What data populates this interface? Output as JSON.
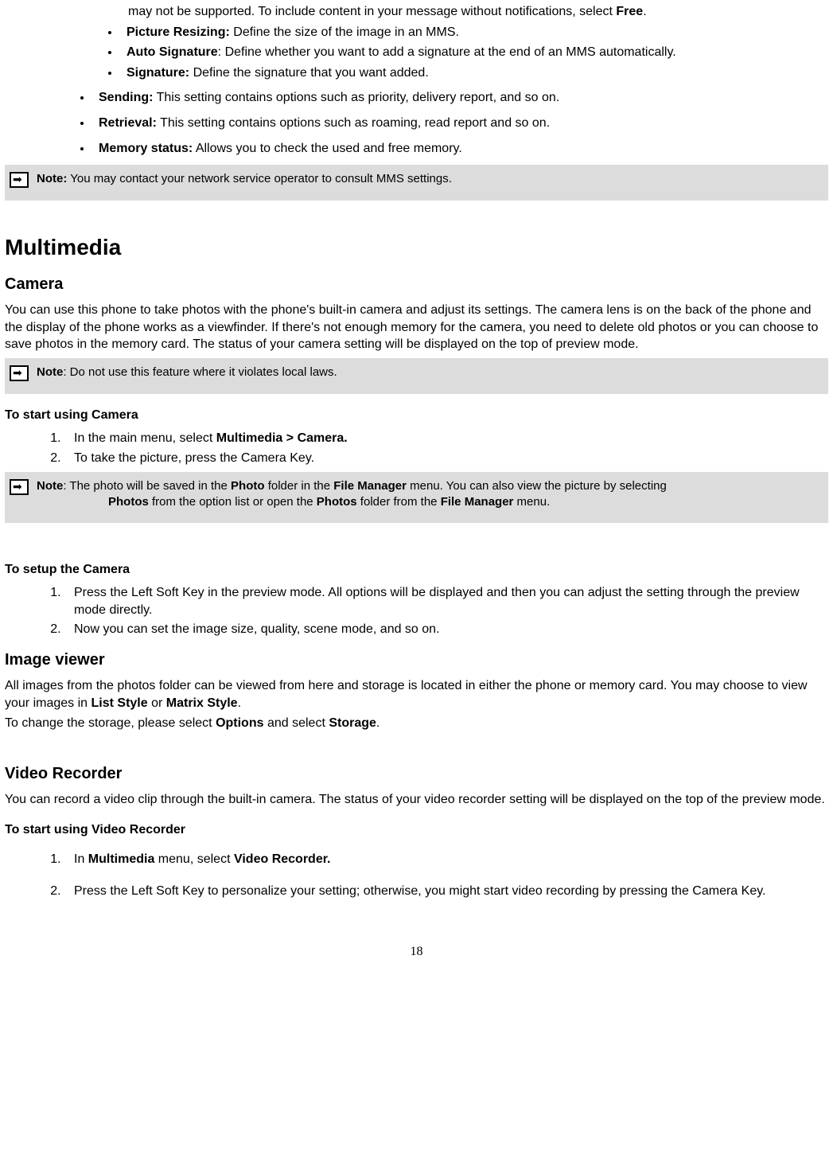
{
  "orphan_text": "may not be supported. To include content in your message without notifications, select ",
  "orphan_bold": "Free",
  "orphan_tail": ".",
  "inner_bullets": [
    {
      "label": "Picture Resizing:",
      "text": " Define the size of the image in an MMS."
    },
    {
      "label": "Auto Signature",
      "text": ": Define whether you want to add a signature at the end of an MMS automatically."
    },
    {
      "label": "Signature:",
      "text": " Define the signature that you want added."
    }
  ],
  "outer_bullets": [
    {
      "label": "Sending:",
      "text": " This setting contains options such as priority, delivery report, and so on."
    },
    {
      "label": "Retrieval:",
      "text": " This setting contains options such as roaming, read report and so on."
    },
    {
      "label": "Memory status:",
      "text": " Allows you to check the used and free memory."
    }
  ],
  "note1": {
    "label": "Note:",
    "text": " You may contact your network service operator to consult MMS settings."
  },
  "h1": "Multimedia",
  "camera_h2": "Camera",
  "camera_p": "You can use this phone to take photos with the phone's built-in camera and adjust its settings. The camera lens is on the back of the phone and the display of the phone works as a viewfinder. If there's not enough memory for the camera, you need to delete old photos or you can choose to save photos in the memory card. The status of your camera setting will be displayed on the top of preview mode.",
  "note2": {
    "label": "Note",
    "text": ": Do not use this feature where it violates local laws."
  },
  "start_cam_h3": "To start using Camera",
  "start_cam_li1_pre": "In the main menu, select ",
  "start_cam_li1_bold": "Multimedia > Camera.",
  "start_cam_li2": "To take the picture, press the Camera Key.",
  "note3": {
    "label": "Note",
    "seg1": ": The photo will be saved in the ",
    "b1": "Photo",
    "seg2": " folder in the ",
    "b2": "File Manager",
    "seg3": " menu. You can also view the picture by selecting ",
    "b3": "Photos",
    "seg4": " from the option list or open the ",
    "b4": "Photos",
    "seg5": " folder from the ",
    "b5": "File Manager",
    "seg6": " menu."
  },
  "setup_cam_h3": "To setup the Camera",
  "setup_cam_li1": "Press the Left Soft Key in the preview mode. All options will be displayed and then you can adjust the setting through the preview mode directly.",
  "setup_cam_li2": "Now you can set the image size, quality, scene mode, and so on.",
  "imgviewer_h2": "Image viewer",
  "imgviewer_p1_pre": "All images from the photos folder can be viewed from here and storage is located in either the phone or memory card. You may choose to view your images in ",
  "imgviewer_p1_b1": "List Style",
  "imgviewer_p1_mid": " or ",
  "imgviewer_p1_b2": "Matrix Style",
  "imgviewer_p1_tail": ".",
  "imgviewer_p2_pre": "To change the storage, please select ",
  "imgviewer_p2_b1": "Options",
  "imgviewer_p2_mid": " and select ",
  "imgviewer_p2_b2": "Storage",
  "imgviewer_p2_tail": ".",
  "vidrec_h2": "Video Recorder",
  "vidrec_p": "You can record a video clip through the built-in camera. The status of your video recorder setting will be displayed on the top of the preview mode.",
  "start_vid_h3": "To start using Video Recorder",
  "start_vid_li1_pre": "In ",
  "start_vid_li1_b1": "Multimedia",
  "start_vid_li1_mid": " menu, select ",
  "start_vid_li1_b2": "Video Recorder.",
  "start_vid_li2": "Press the Left Soft Key to personalize your setting; otherwise, you might start video recording by pressing the Camera Key.",
  "page_num": "18"
}
